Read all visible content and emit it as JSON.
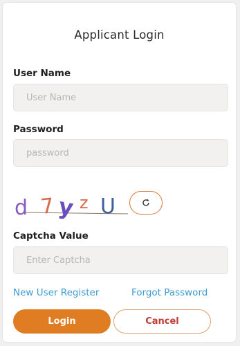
{
  "header": {
    "title": "Applicant Login"
  },
  "form": {
    "username": {
      "label": "User Name",
      "placeholder": "User Name",
      "value": ""
    },
    "password": {
      "label": "Password",
      "placeholder": "password",
      "value": ""
    },
    "captcha": {
      "image_text": "d7yzU",
      "refresh_icon": "refresh-icon",
      "label": "Captcha Value",
      "placeholder": "Enter Captcha",
      "value": ""
    }
  },
  "links": {
    "register": "New User Register",
    "forgot": "Forgot Password"
  },
  "buttons": {
    "login": "Login",
    "cancel": "Cancel"
  },
  "colors": {
    "accent": "#e07d22",
    "link": "#3d9bd1",
    "cancel_text": "#c23b34"
  }
}
